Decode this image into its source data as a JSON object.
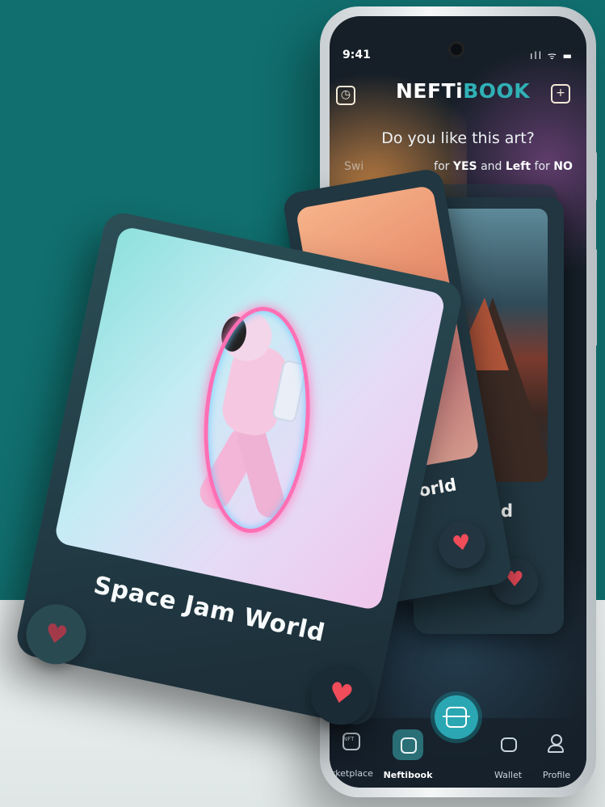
{
  "status": {
    "time": "9:41",
    "icons": "ıll ᯤ ▬"
  },
  "header": {
    "brand_part1": "NEFTi",
    "brand_part2": "BOOK",
    "history_icon": "clock-icon",
    "add_icon": "plus-square-icon"
  },
  "prompt": {
    "question": "Do you like this art?",
    "instr_prefix": "Swi",
    "instr_mid": "for ",
    "yes": "YES",
    "and": " and ",
    "left": "Left",
    "for_no": " for ",
    "no": "NO"
  },
  "cards": {
    "front": {
      "title": "Space Jam World"
    },
    "middle": {
      "title_fragment": "orld"
    },
    "back": {
      "title_fragment": "orld"
    }
  },
  "nav": {
    "items": [
      {
        "label": "arketplace",
        "icon": "bag-icon"
      },
      {
        "label": "Neftibook",
        "icon": "book-icon"
      },
      {
        "label": "Wallet",
        "icon": "wallet-icon"
      },
      {
        "label": "Profile",
        "icon": "user-icon"
      }
    ],
    "scan_icon": "scan-icon",
    "nft_badge": "NFT"
  },
  "colors": {
    "background_teal": "#116f6f",
    "accent": "#2fb1b6",
    "heart": "#f04c5a"
  }
}
